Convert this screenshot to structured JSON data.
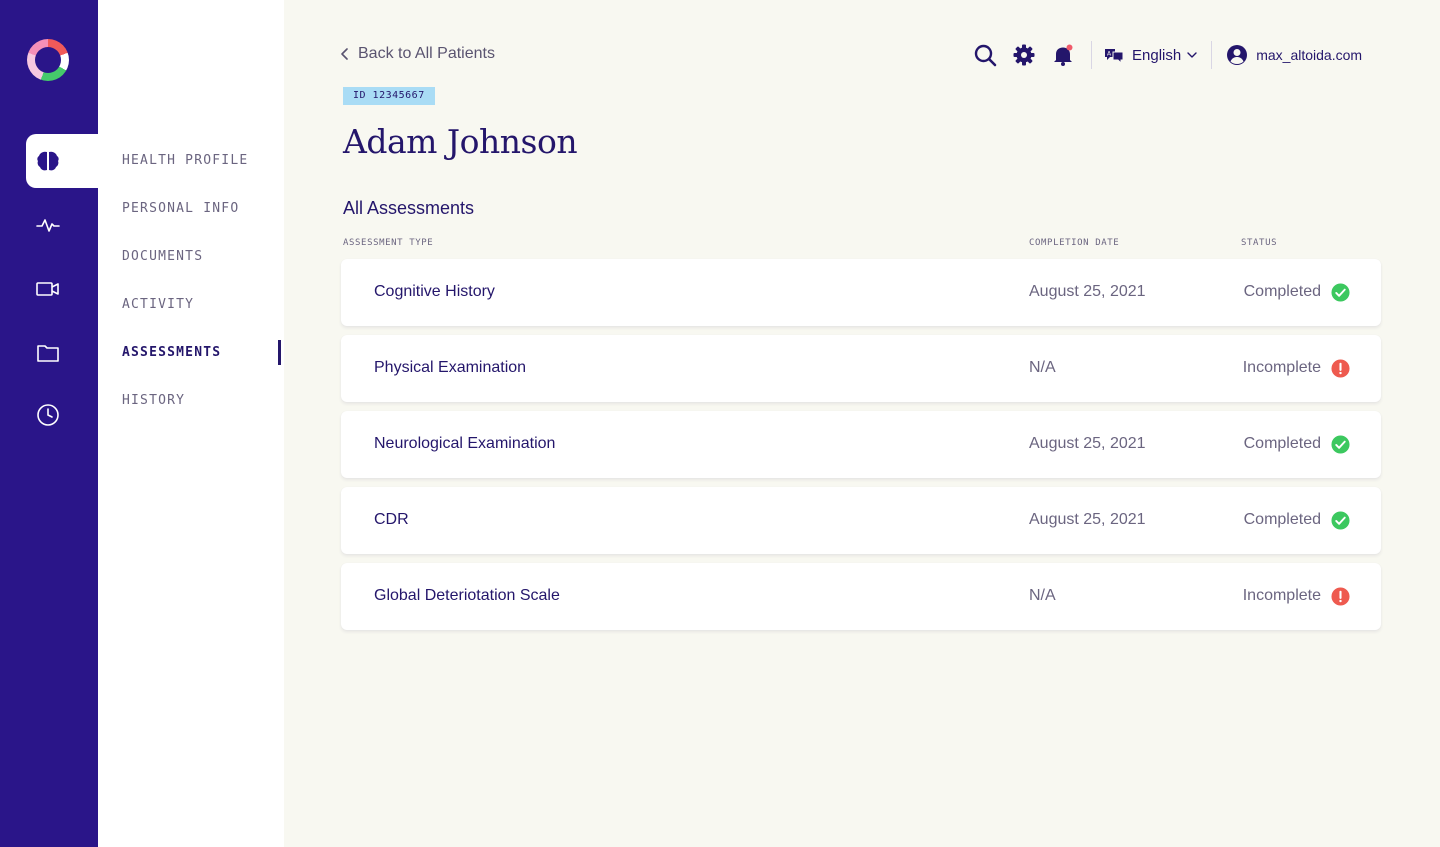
{
  "rail": {
    "items": [
      {
        "name": "brain",
        "active": true
      },
      {
        "name": "activity-pulse",
        "active": false
      },
      {
        "name": "video-camera",
        "active": false
      },
      {
        "name": "folder",
        "active": false
      },
      {
        "name": "clock",
        "active": false
      }
    ]
  },
  "subnav": {
    "items": [
      {
        "label": "HEALTH PROFILE",
        "active": false
      },
      {
        "label": "PERSONAL INFO",
        "active": false
      },
      {
        "label": "DOCUMENTS",
        "active": false
      },
      {
        "label": "ACTIVITY",
        "active": false
      },
      {
        "label": "ASSESSMENTS",
        "active": true
      },
      {
        "label": "HISTORY",
        "active": false
      }
    ]
  },
  "header": {
    "back_label": "Back to All Patients",
    "language": "English",
    "user": "max_altoida.com",
    "icons": [
      "search-icon",
      "gear-icon",
      "bell-icon",
      "translate-icon",
      "user-icon"
    ]
  },
  "patient": {
    "id_badge": "ID 12345667",
    "name": "Adam Johnson"
  },
  "assessments": {
    "title": "All Assessments",
    "columns": {
      "type": "ASSESSMENT TYPE",
      "date": "COMPLETION DATE",
      "status": "STATUS"
    },
    "rows": [
      {
        "type": "Cognitive History",
        "date": "August 25, 2021",
        "status": "Completed"
      },
      {
        "type": "Physical Examination",
        "date": "N/A",
        "status": "Incomplete"
      },
      {
        "type": "Neurological Examination",
        "date": "August 25, 2021",
        "status": "Completed"
      },
      {
        "type": "CDR",
        "date": "August 25, 2021",
        "status": "Completed"
      },
      {
        "type": "Global Deteriotation Scale",
        "date": "N/A",
        "status": "Incomplete"
      }
    ]
  },
  "colors": {
    "rail_bg": "#2a1589",
    "text_primary": "#24166b",
    "page_bg": "#f8f8f1",
    "badge_bg": "#a9dcf5",
    "completed": "#3cc85f",
    "incomplete": "#ee5a4f",
    "notification_dot": "#f05a6a"
  }
}
